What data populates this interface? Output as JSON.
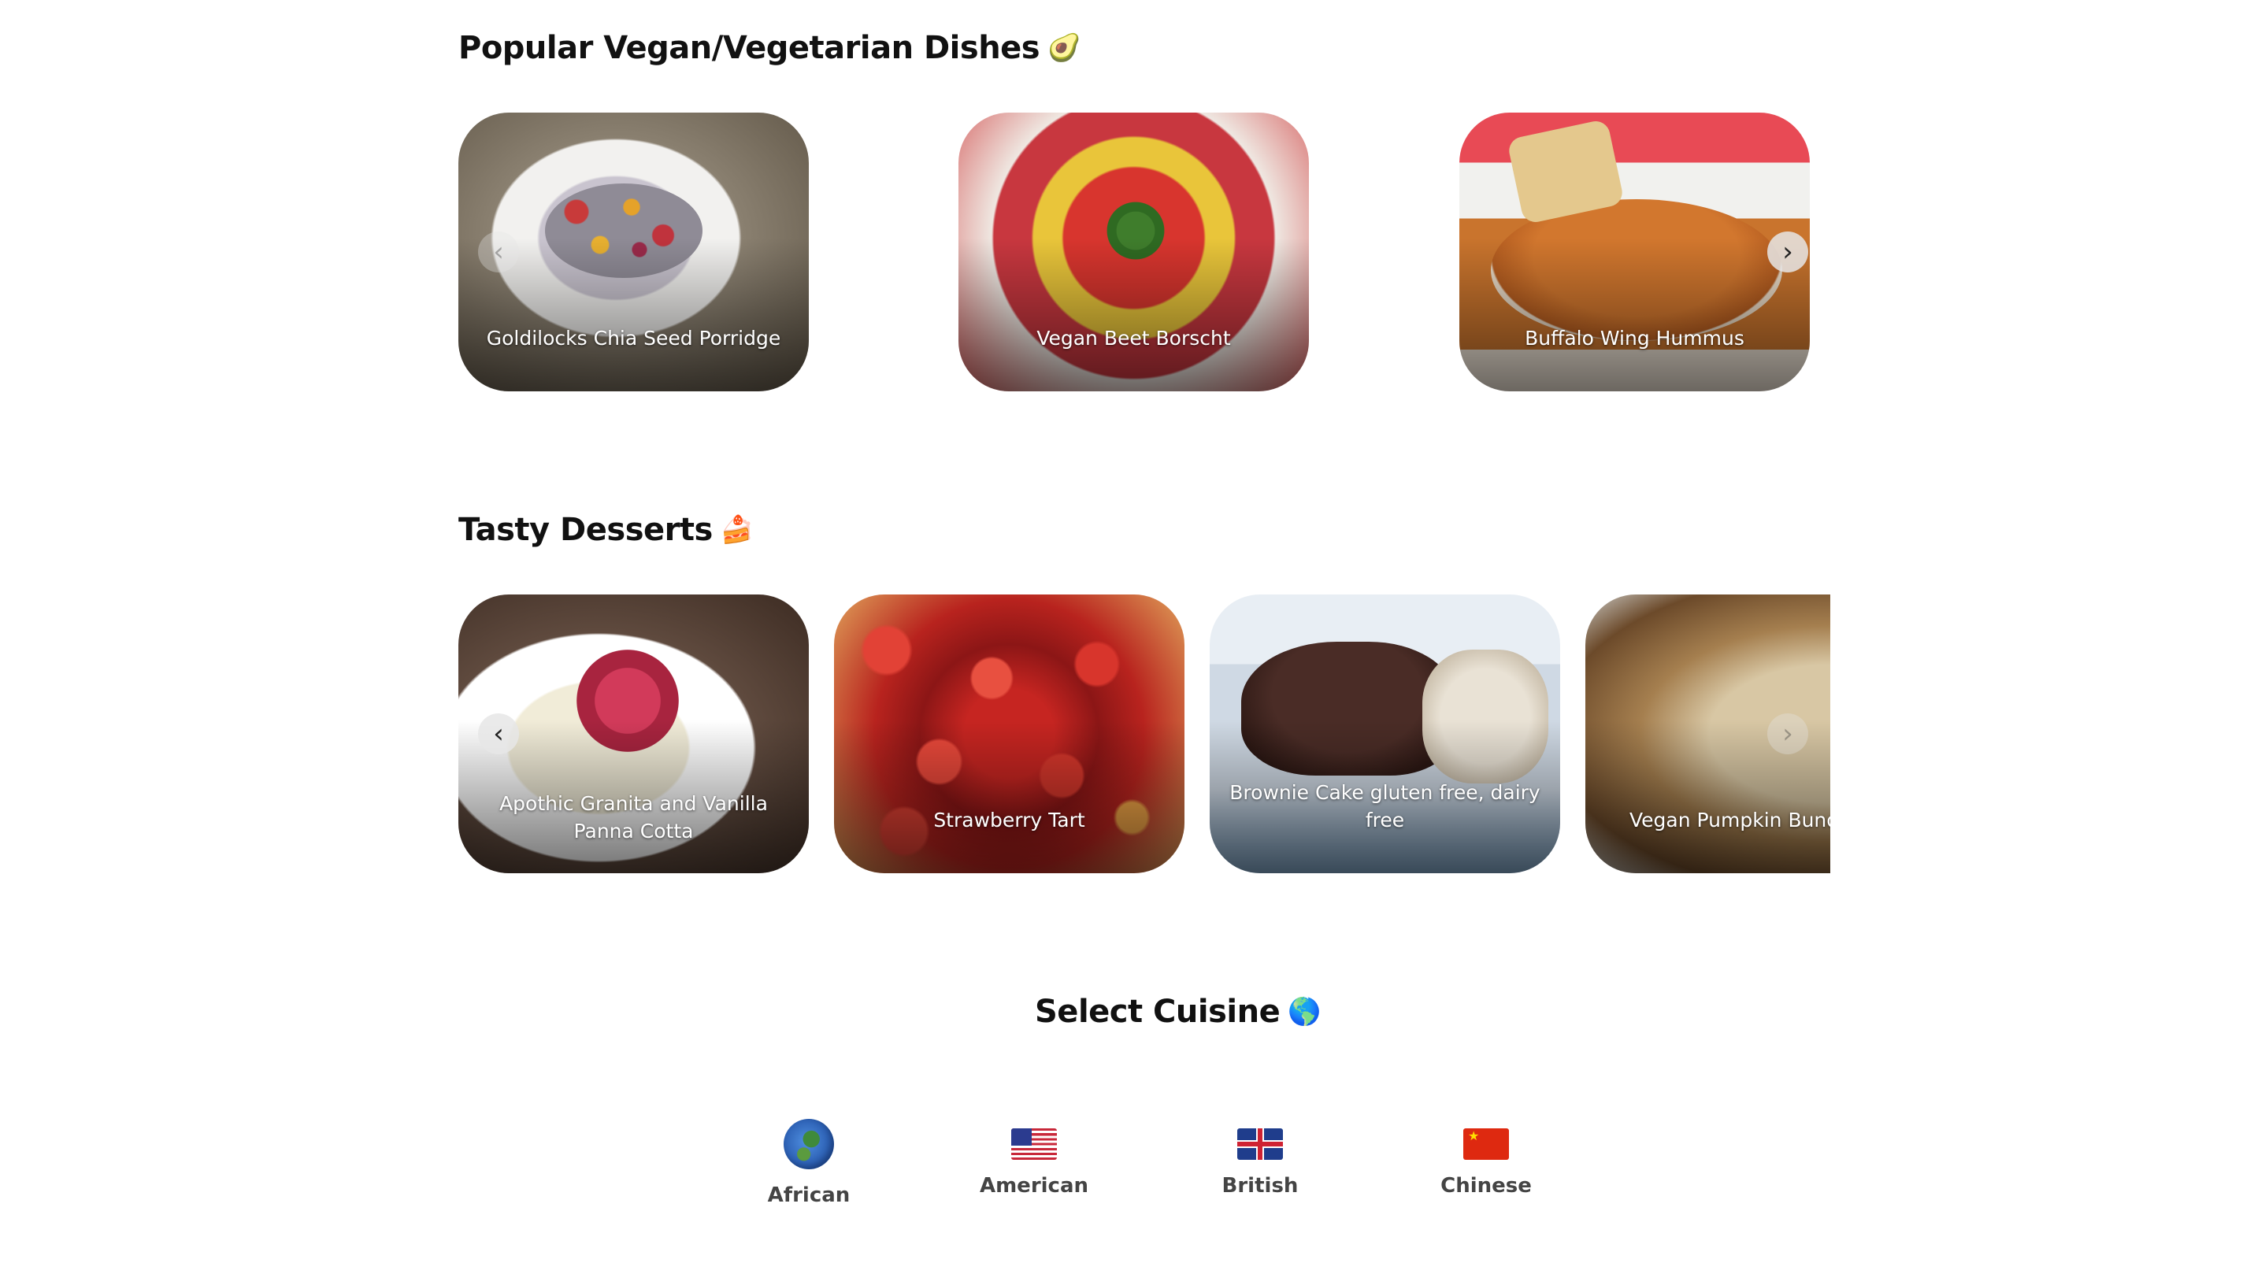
{
  "sections": {
    "vegan": {
      "title": "Popular Vegan/Vegetarian Dishes",
      "emoji": "🥑",
      "cards": [
        {
          "label": "Goldilocks Chia Seed Porridge"
        },
        {
          "label": "Vegan Beet Borscht"
        },
        {
          "label": "Buffalo Wing Hummus"
        }
      ],
      "prev_arrow": "‹",
      "next_arrow": "›"
    },
    "desserts": {
      "title": "Tasty Desserts",
      "emoji": "🍰",
      "cards": [
        {
          "label": "Apothic Granita and Vanilla Panna Cotta"
        },
        {
          "label": "Strawberry Tart"
        },
        {
          "label": "Brownie Cake gluten free, dairy free"
        },
        {
          "label": "Vegan Pumpkin Bundt Cake"
        }
      ],
      "prev_arrow": "‹",
      "next_arrow": "›"
    },
    "cuisine": {
      "title": "Select Cuisine",
      "emoji": "🌎",
      "items": [
        {
          "name": "African",
          "icon": "globe-africa-icon"
        },
        {
          "name": "American",
          "icon": "us-flag-icon"
        },
        {
          "name": "British",
          "icon": "uk-flag-icon"
        },
        {
          "name": "Chinese",
          "icon": "china-flag-icon"
        }
      ]
    }
  }
}
